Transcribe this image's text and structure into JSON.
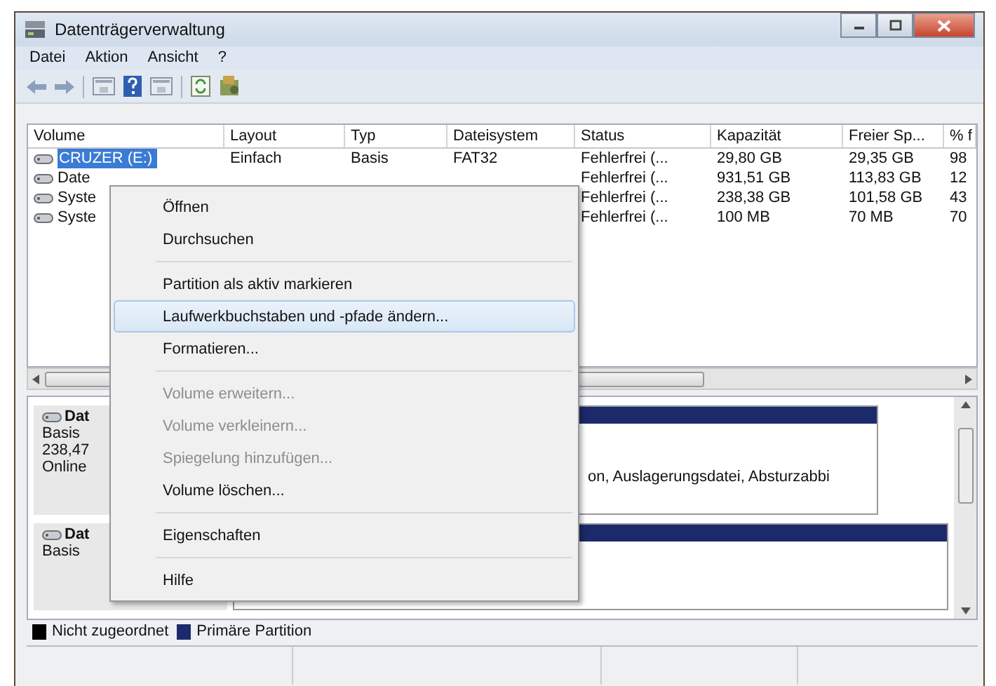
{
  "window": {
    "title": "Datenträgerverwaltung"
  },
  "menu_bar": [
    "Datei",
    "Aktion",
    "Ansicht",
    "?"
  ],
  "volume_table": {
    "columns": [
      "Volume",
      "Layout",
      "Typ",
      "Dateisystem",
      "Status",
      "Kapazität",
      "Freier Sp...",
      "% f"
    ],
    "rows": [
      {
        "selected": true,
        "volume": "CRUZER (E:)",
        "layout": "Einfach",
        "typ": "Basis",
        "dateisystem": "FAT32",
        "status": "Fehlerfrei (...",
        "kapazitaet": "29,80 GB",
        "frei": "29,35 GB",
        "prozent": "98"
      },
      {
        "selected": false,
        "volume": "Date",
        "status": "Fehlerfrei (...",
        "kapazitaet": "931,51 GB",
        "frei": "113,83 GB",
        "prozent": "12"
      },
      {
        "selected": false,
        "volume": "Syste",
        "status": "Fehlerfrei (...",
        "kapazitaet": "238,38 GB",
        "frei": "101,58 GB",
        "prozent": "43"
      },
      {
        "selected": false,
        "volume": "Syste",
        "status": "Fehlerfrei (...",
        "kapazitaet": "100 MB",
        "frei": "70 MB",
        "prozent": "70"
      }
    ]
  },
  "disks": [
    {
      "name": "Dat",
      "type": "Basis",
      "size": "238,47",
      "state": "Online",
      "partition_text": "on, Auslagerungsdatei, Absturzabbi"
    },
    {
      "name": "Dat",
      "type": "Basis"
    }
  ],
  "legend": [
    {
      "label": "Nicht zugeordnet",
      "color": "#000000"
    },
    {
      "label": "Primäre Partition",
      "color": "#1c2a6b"
    }
  ],
  "context_menu": [
    {
      "kind": "item",
      "label": "Öffnen",
      "disabled": false,
      "selected": false
    },
    {
      "kind": "item",
      "label": "Durchsuchen",
      "disabled": false,
      "selected": false
    },
    {
      "kind": "separator"
    },
    {
      "kind": "item",
      "label": "Partition als aktiv markieren",
      "disabled": false,
      "selected": false
    },
    {
      "kind": "item",
      "label": "Laufwerkbuchstaben und -pfade ändern...",
      "disabled": false,
      "selected": true
    },
    {
      "kind": "item",
      "label": "Formatieren...",
      "disabled": false,
      "selected": false
    },
    {
      "kind": "separator"
    },
    {
      "kind": "item",
      "label": "Volume erweitern...",
      "disabled": true,
      "selected": false
    },
    {
      "kind": "item",
      "label": "Volume verkleinern...",
      "disabled": true,
      "selected": false
    },
    {
      "kind": "item",
      "label": "Spiegelung hinzufügen...",
      "disabled": true,
      "selected": false
    },
    {
      "kind": "item",
      "label": "Volume löschen...",
      "disabled": false,
      "selected": false
    },
    {
      "kind": "separator"
    },
    {
      "kind": "item",
      "label": "Eigenschaften",
      "disabled": false,
      "selected": false
    },
    {
      "kind": "separator"
    },
    {
      "kind": "item",
      "label": "Hilfe",
      "disabled": false,
      "selected": false
    }
  ]
}
